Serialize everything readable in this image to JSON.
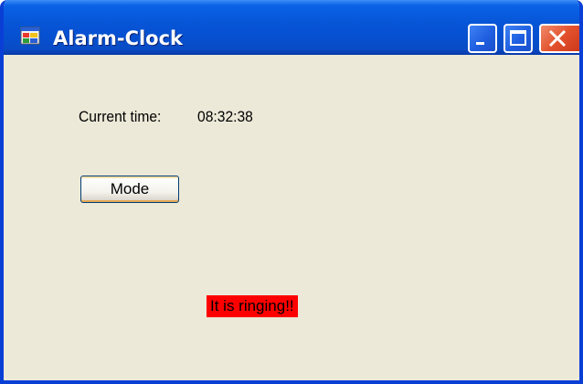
{
  "window": {
    "title": "Alarm-Clock",
    "icon": "app-window-icon"
  },
  "titlebar_buttons": {
    "minimize_icon": "minimize-icon",
    "maximize_icon": "maximize-icon",
    "close_icon": "close-icon"
  },
  "main": {
    "time_label": "Current time:",
    "time_value": "08:32:38",
    "mode_button_label": "Mode",
    "alarm_status": "It is ringing!!"
  },
  "colors": {
    "titlebar": "#0754d6",
    "window_background": "#ece9d8",
    "alarm_background": "#ff0000",
    "close_button": "#e2502b"
  }
}
